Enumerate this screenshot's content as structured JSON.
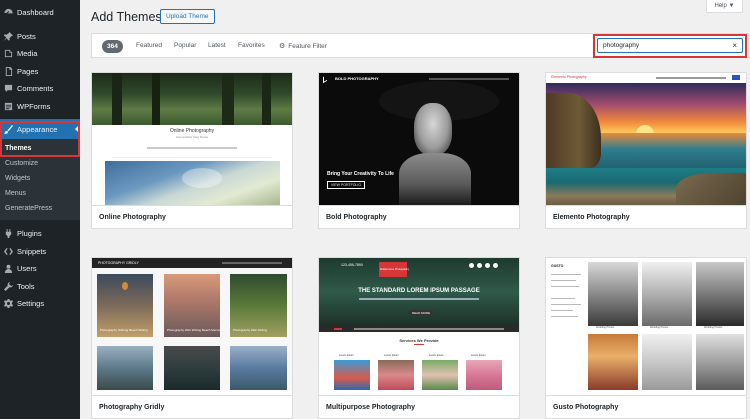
{
  "sidebar": {
    "items": [
      {
        "label": "Dashboard",
        "icon": "dashboard-icon"
      },
      {
        "label": "Posts",
        "icon": "pin-icon"
      },
      {
        "label": "Media",
        "icon": "media-icon"
      },
      {
        "label": "Pages",
        "icon": "pages-icon"
      },
      {
        "label": "Comments",
        "icon": "comment-icon"
      },
      {
        "label": "WPForms",
        "icon": "form-icon"
      }
    ],
    "appearance": "Appearance",
    "submenu": [
      "Themes",
      "Customize",
      "Widgets",
      "Menus",
      "GeneratePress"
    ],
    "items_bottom": [
      {
        "label": "Plugins",
        "icon": "plugin-icon"
      },
      {
        "label": "Snippets",
        "icon": "snippets-icon"
      },
      {
        "label": "Users",
        "icon": "users-icon"
      },
      {
        "label": "Tools",
        "icon": "tools-icon"
      },
      {
        "label": "Settings",
        "icon": "settings-icon"
      }
    ]
  },
  "header": {
    "title": "Add Themes",
    "upload_label": "Upload Theme",
    "help_label": "Help ▼"
  },
  "filters": {
    "count": "364",
    "featured": "Featured",
    "popular": "Popular",
    "latest": "Latest",
    "favorites": "Favorites",
    "feature_filter": "Feature Filter"
  },
  "search": {
    "value": "photography",
    "clear": "×"
  },
  "themes": [
    {
      "name": "Online Photography",
      "preview": {
        "title": "Online Photography",
        "tagline": "Just another blog theme"
      }
    },
    {
      "name": "Bold Photography",
      "preview": {
        "brand": "BOLD PHOTOGRAPHY",
        "headline": "Bring Your Creativity To Life",
        "button": "VIEW PORTFOLIO"
      }
    },
    {
      "name": "Elemento Photography",
      "preview": {
        "brand": "Elemento Photography"
      }
    },
    {
      "name": "Photography Gridly",
      "preview": {
        "brand": "PHOTOGRAPHY GRIDLY",
        "captions": [
          "Photography Nothing Beach Writing",
          "Photography Web Writing Beach Memories",
          "Photography Web Writing",
          "",
          "",
          ""
        ]
      }
    },
    {
      "name": "Multipurpose Photography",
      "preview": {
        "phone": "123-456-7890",
        "brand": "Multipurpose Photography",
        "headline": "THE STANDARD LOREM IPSUM PASSAGE",
        "button": "READ MORE",
        "section": "Services We Provide",
        "services": [
          "Lorem Ipsum",
          "Lorem Ipsum",
          "Lorem Ipsum",
          "Lorem Ipsum"
        ]
      }
    },
    {
      "name": "Gusto Photography",
      "preview": {
        "brand": "GUSTO",
        "captions": [
          "Wedding Photos",
          "Wedding Photos",
          "Wedding Photos"
        ]
      }
    }
  ]
}
